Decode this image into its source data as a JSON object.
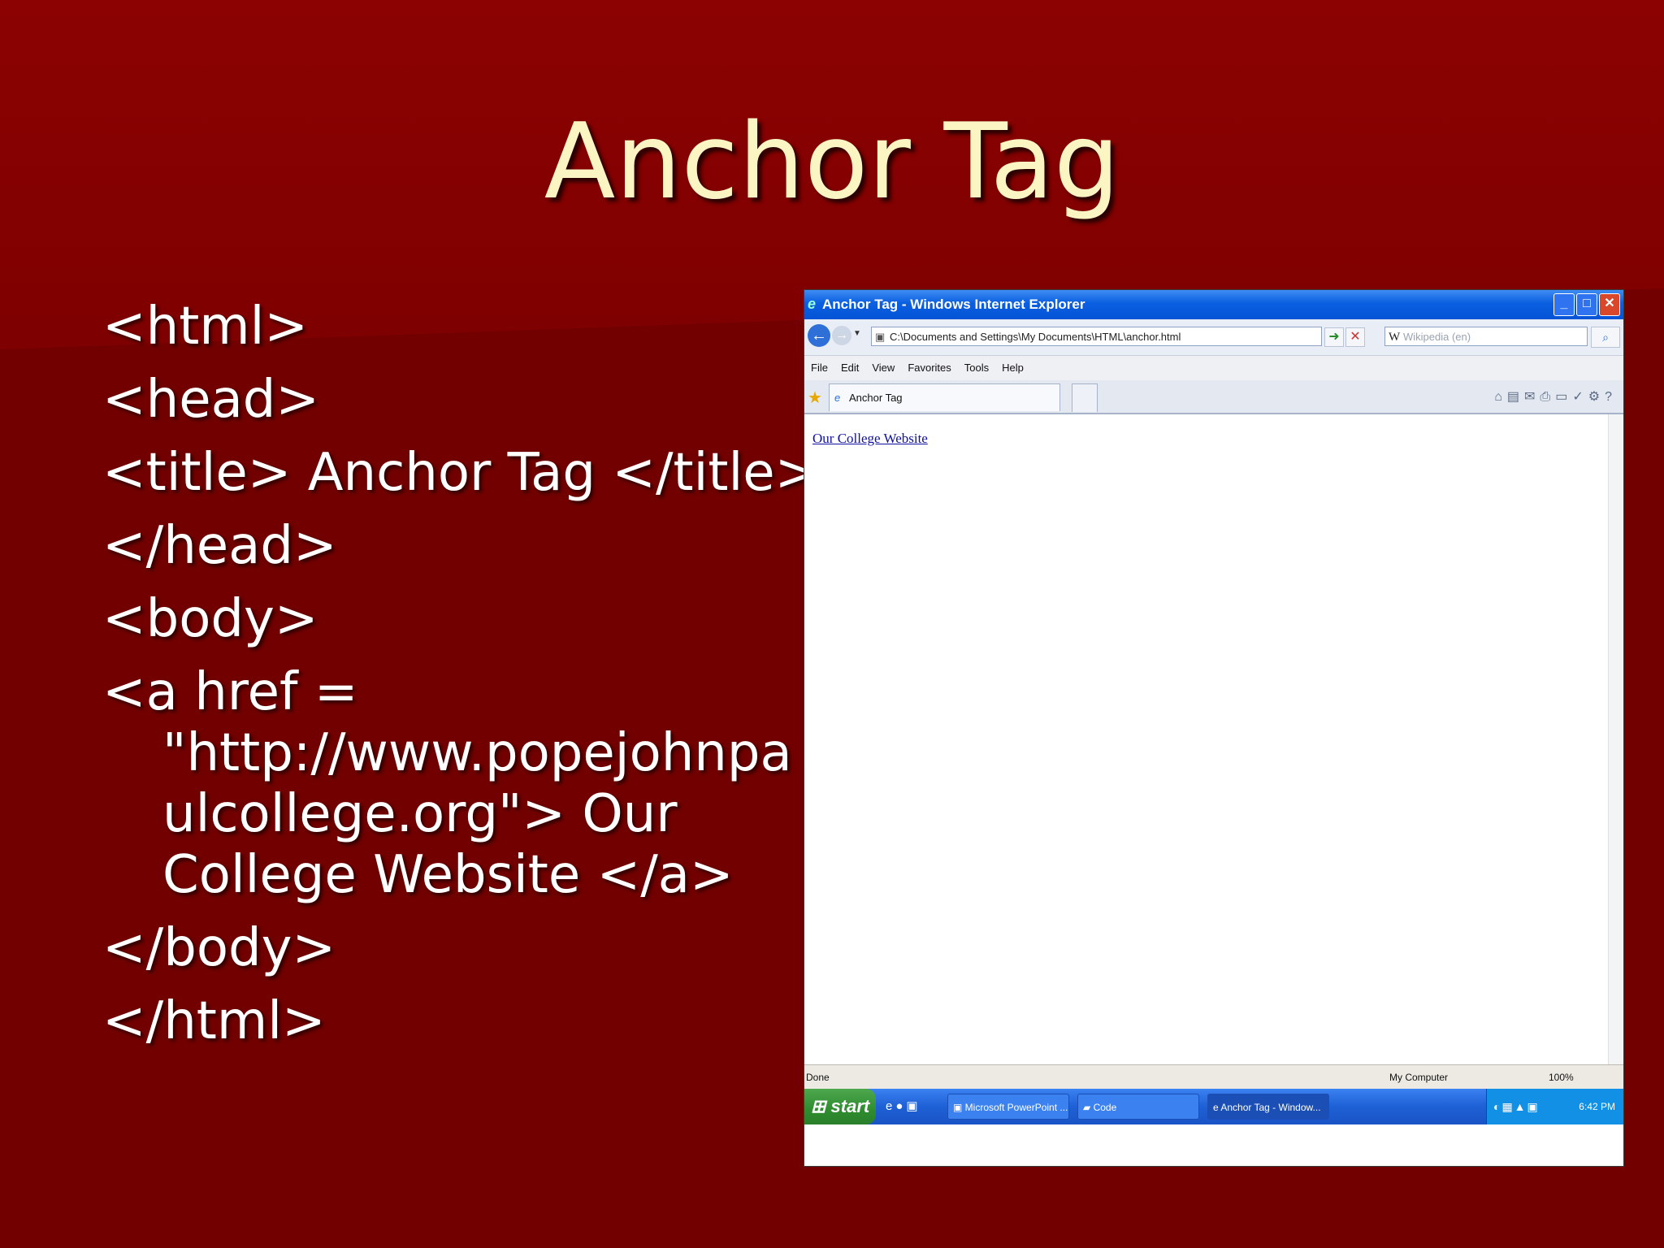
{
  "slide": {
    "title": "Anchor Tag",
    "code_lines": [
      "<html>",
      "<head>",
      "<title> Anchor Tag </title>",
      "</head>",
      "<body>",
      "<a href =",
      "\"http://www.popejohnpa",
      "ulcollege.org\"> Our",
      "College Website </a>",
      "</body>",
      "</html>"
    ]
  },
  "browser": {
    "window_title": "Anchor Tag - Windows Internet Explorer",
    "address": "C:\\Documents and Settings\\My Documents\\HTML\\anchor.html",
    "search_placeholder": "Wikipedia (en)",
    "menu": [
      "File",
      "Edit",
      "View",
      "Favorites",
      "Tools",
      "Help"
    ],
    "tab_label": "Anchor Tag",
    "page_link_text": "Our College Website",
    "status_text": "Done",
    "zone_text": "My Computer",
    "zoom_text": "100%"
  },
  "taskbar": {
    "start_label": "start",
    "tasks": [
      "Microsoft PowerPoint ...",
      "Code",
      "Anchor Tag - Window..."
    ],
    "clock": "6:42 PM"
  },
  "colors": {
    "background": "#720000",
    "title_color": "#fbf5c4",
    "link_color": "#1010a0"
  }
}
